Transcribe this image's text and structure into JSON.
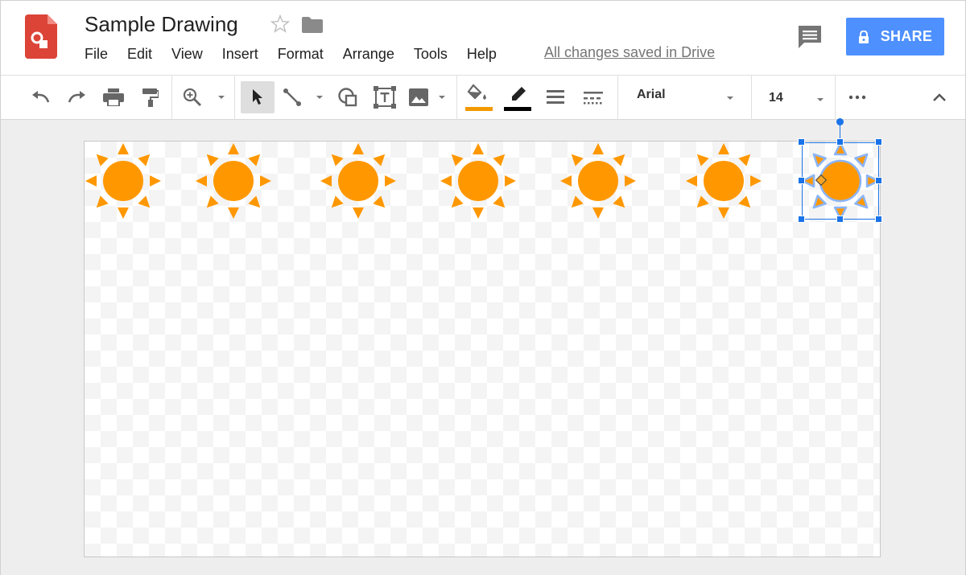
{
  "app": {
    "title": "Sample Drawing",
    "save_status": "All changes saved in Drive",
    "share_label": "SHARE"
  },
  "menu": {
    "items": [
      "File",
      "Edit",
      "View",
      "Insert",
      "Format",
      "Arrange",
      "Tools",
      "Help"
    ]
  },
  "toolbar": {
    "tools": [
      "undo-icon",
      "redo-icon",
      "print-icon",
      "paint-format-icon",
      "zoom-icon",
      "select-icon",
      "line-icon",
      "shape-icon",
      "text-box-icon",
      "image-icon",
      "fill-color-icon",
      "line-color-icon",
      "line-weight-icon",
      "line-dash-icon",
      "more-icon",
      "collapse-icon"
    ],
    "fill_color": "#f29900",
    "line_color": "#000000",
    "font": "Arial",
    "font_size": "14"
  },
  "canvas": {
    "shape_type": "sun",
    "shape_count": 7,
    "shape_color": "#ff9800",
    "selected_index": 6,
    "selection_color": "#1a73e8"
  },
  "colors": {
    "accent": "#4d90fe",
    "logo": "#db4437"
  }
}
